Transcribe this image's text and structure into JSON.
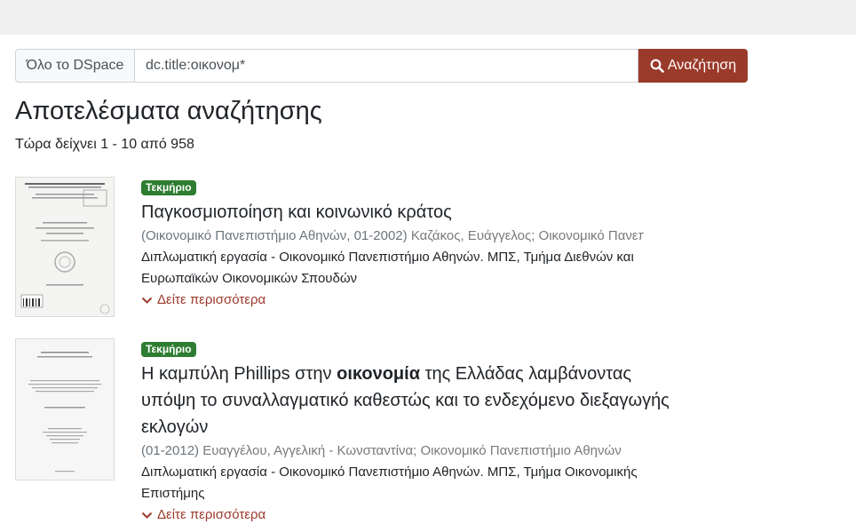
{
  "search": {
    "scope_label": "Όλο το DSpace",
    "query_value": "dc.title:οικονομ*",
    "button_label": "Αναζήτηση"
  },
  "results_heading": "Αποτελέσματα αναζήτησης",
  "results_count": "Τώρα δείχνει 1 - 10 από 958",
  "colors": {
    "accent": "#9a3a2a",
    "badge": "#2e7d32"
  },
  "results": [
    {
      "badge": "Τεκμήριο",
      "title": "Παγκοσμιοποίηση και κοινωνικό κράτος",
      "meta_date": "(Οικονομικό Πανεπιστήμιο Αθηνών, 01-2002)",
      "meta_authors": "Καζάκος, Ευάγγελος; Οικονομικό Πανεπιστήμιο Αθηνών",
      "abstract": "Διπλωματική εργασία - Οικονομικό Πανεπιστήμιο Αθηνών. ΜΠΣ, Τμήμα Διεθνών και Ευρωπαϊκών Οικονομικών Σπουδών",
      "more_label": "Δείτε περισσότερα"
    },
    {
      "badge": "Τεκμήριο",
      "title_before": "Η καμπύλη Phillips στην ",
      "title_highlight": "οικονομία",
      "title_after": " της Ελλάδας λαμβάνοντας υπόψη το συναλλαγματικό καθεστώς και το ενδεχόμενο διεξαγωγής εκλογών",
      "meta_date": "(01-2012)",
      "meta_authors": "Ευαγγέλου, Αγγελική - Κωνσταντίνα; Οικονομικό Πανεπιστήμιο Αθηνών",
      "abstract": "Διπλωματική εργασία - Οικονομικό Πανεπιστήμιο Αθηνών. ΜΠΣ, Τμήμα Οικονομικής Επιστήμης",
      "more_label": "Δείτε περισσότερα"
    }
  ]
}
